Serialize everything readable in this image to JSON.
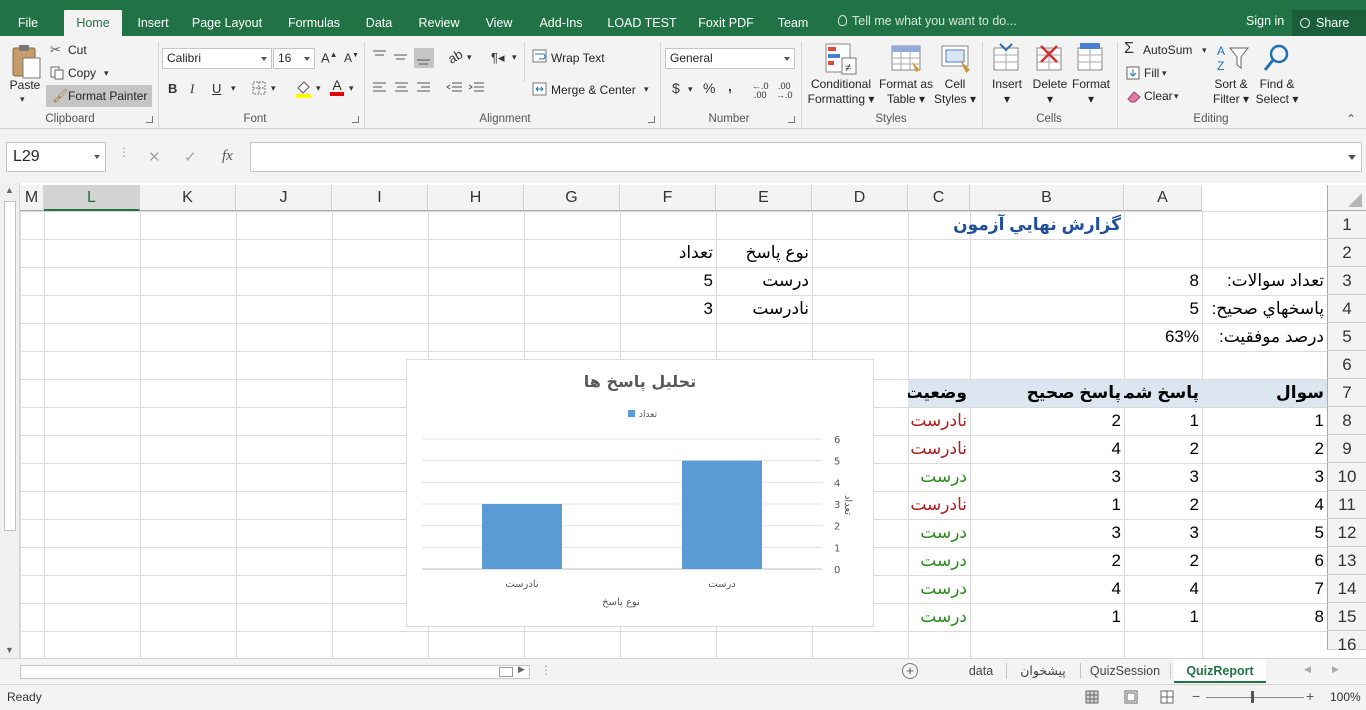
{
  "ribbon_tabs": [
    "File",
    "Home",
    "Insert",
    "Page Layout",
    "Formulas",
    "Data",
    "Review",
    "View",
    "Add-Ins",
    "LOAD TEST",
    "Foxit PDF",
    "Team"
  ],
  "active_tab": "Home",
  "tell_me": "Tell me what you want to do...",
  "sign_in": "Sign in",
  "share": "Share",
  "clipboard": {
    "paste": "Paste",
    "cut": "Cut",
    "copy": "Copy",
    "format_painter": "Format Painter",
    "label": "Clipboard"
  },
  "font": {
    "name": "Calibri",
    "size": "16",
    "label": "Font",
    "bold": "B",
    "italic": "I",
    "underline": "U"
  },
  "alignment": {
    "wrap_text": "Wrap Text",
    "merge_center": "Merge & Center",
    "label": "Alignment"
  },
  "number": {
    "format": "General",
    "label": "Number",
    "currency": "$",
    "percent": "%",
    "comma": ","
  },
  "styles": {
    "conditional_formatting": [
      "Conditional",
      "Formatting"
    ],
    "format_as_table": [
      "Format as",
      "Table"
    ],
    "cell_styles": [
      "Cell",
      "Styles"
    ],
    "label": "Styles"
  },
  "cells": {
    "insert": "Insert",
    "delete": "Delete",
    "format": "Format",
    "label": "Cells"
  },
  "editing": {
    "autosum": "AutoSum",
    "fill": "Fill",
    "clear": "Clear",
    "sort_filter": [
      "Sort &",
      "Filter"
    ],
    "find_select": [
      "Find &",
      "Select"
    ],
    "label": "Editing"
  },
  "name_box": "L29",
  "fx": "fx",
  "columns": [
    "M",
    "L",
    "K",
    "J",
    "I",
    "H",
    "G",
    "F",
    "E",
    "D",
    "C",
    "B",
    "A"
  ],
  "selected_column": "L",
  "rows": [
    "1",
    "2",
    "3",
    "4",
    "5",
    "6",
    "7",
    "8",
    "9",
    "10",
    "11",
    "12",
    "13",
    "14",
    "15",
    "16"
  ],
  "sheet": {
    "title": "گزارش نهايي آزمون",
    "summary": [
      {
        "label": "تعداد سوالات:",
        "value": "8"
      },
      {
        "label": "پاسخهاي صحيح:",
        "value": "5"
      },
      {
        "label": "درصد موفقيت:",
        "value": "63%"
      }
    ],
    "answer_type_header": "نوع پاسخ",
    "count_header": "تعداد",
    "answer_types": [
      {
        "type": "درست",
        "count": "5"
      },
      {
        "type": "نادرست",
        "count": "3"
      }
    ],
    "table_headers": {
      "question": "سوال",
      "your_answer": "پاسخ شما",
      "correct_answer": "پاسخ صحيح",
      "status": "وضعيت"
    },
    "table_rows": [
      {
        "q": "1",
        "yours": "1",
        "correct": "2",
        "status": "نادرست",
        "ok": false
      },
      {
        "q": "2",
        "yours": "2",
        "correct": "4",
        "status": "نادرست",
        "ok": false
      },
      {
        "q": "3",
        "yours": "3",
        "correct": "3",
        "status": "درست",
        "ok": true
      },
      {
        "q": "4",
        "yours": "2",
        "correct": "1",
        "status": "نادرست",
        "ok": false
      },
      {
        "q": "5",
        "yours": "3",
        "correct": "3",
        "status": "درست",
        "ok": true
      },
      {
        "q": "6",
        "yours": "2",
        "correct": "2",
        "status": "درست",
        "ok": true
      },
      {
        "q": "7",
        "yours": "4",
        "correct": "4",
        "status": "درست",
        "ok": true
      },
      {
        "q": "8",
        "yours": "1",
        "correct": "1",
        "status": "درست",
        "ok": true
      }
    ],
    "correct_color": "#2a8a1e",
    "incorrect_color": "#b02020",
    "title_color": "#1f4e9a",
    "header_fill": "#dce6f1"
  },
  "chart_data": {
    "type": "bar",
    "title": "تحليل پاسخ ها",
    "legend": [
      "تعداد"
    ],
    "legend_position": "top",
    "categories": [
      "نادرست",
      "درست"
    ],
    "values": [
      3,
      5
    ],
    "xlabel": "نوع پاسخ",
    "ylabel": "تعداد",
    "ylim": [
      0,
      6
    ],
    "yticks": [
      0,
      1,
      2,
      3,
      4,
      5,
      6
    ],
    "y_axis_side": "right",
    "grid": true,
    "bar_color": "#5b9bd5"
  },
  "sheet_tabs": [
    "data",
    "پيشخوان",
    "QuizSession",
    "QuizReport"
  ],
  "active_sheet": "QuizReport",
  "status": "Ready",
  "zoom": "100%"
}
